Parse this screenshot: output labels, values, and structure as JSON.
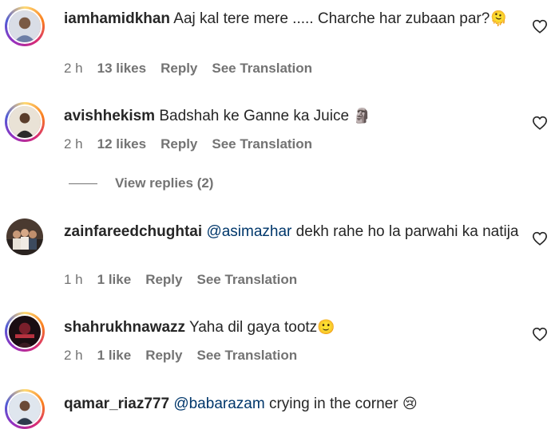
{
  "comments": [
    {
      "username": "iamhamidkhan",
      "text": " Aaj kal tere mere ..... Charche har zubaan par?",
      "emoji": "🫠",
      "time": "2 h",
      "likes": "13 likes",
      "reply": "Reply",
      "translation": "See Translation"
    },
    {
      "username": "avishhekism",
      "text": " Badshah ke Ganne ka Juice ",
      "emoji": "🗿",
      "time": "2 h",
      "likes": "12 likes",
      "reply": "Reply",
      "translation": "See Translation"
    },
    {
      "username": "zainfareedchughtai",
      "mention": "@asimazhar",
      "text": " dekh rahe ho la parwahi ka natija",
      "time": "1 h",
      "likes": "1 like",
      "reply": "Reply",
      "translation": "See Translation"
    },
    {
      "username": "shahrukhnawazz",
      "text": " Yaha dil gaya tootz",
      "emoji": "🙂",
      "time": "2 h",
      "likes": "1 like",
      "reply": "Reply",
      "translation": "See Translation"
    },
    {
      "username": "qamar_riaz777",
      "mention": "@babarazam",
      "text": " crying in the corner ",
      "emoji": "😢"
    }
  ],
  "view_replies": "View replies (2)",
  "icons": {
    "like": "heart-outline-icon"
  },
  "colors": {
    "text": "#262626",
    "secondary": "#737373",
    "mention": "#00376b"
  }
}
